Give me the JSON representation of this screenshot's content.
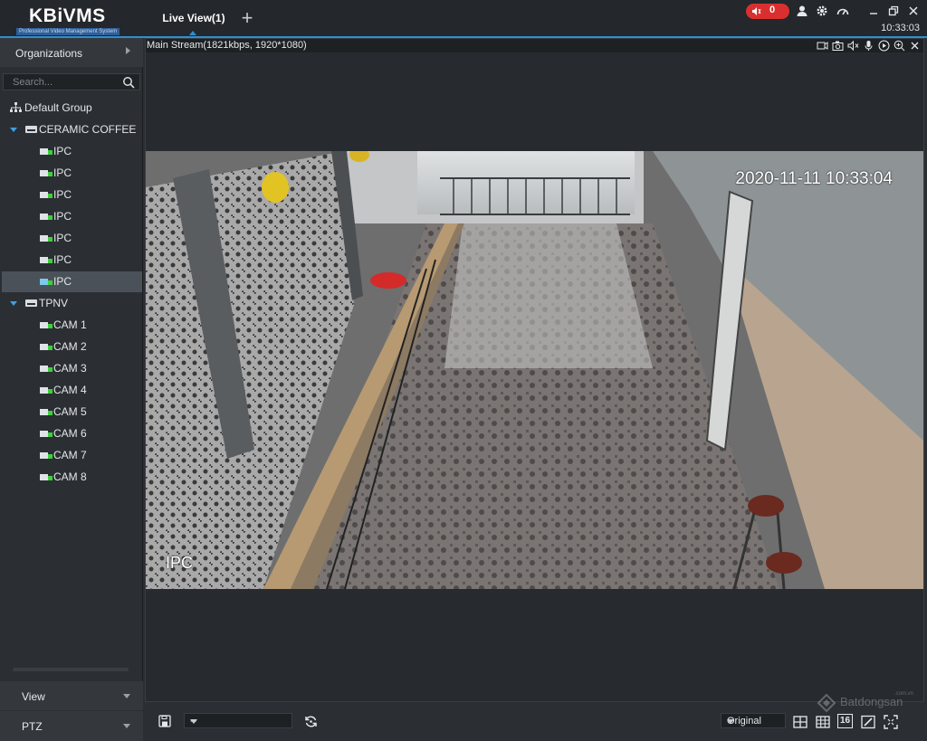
{
  "app": {
    "logo_text": "KBiVMS",
    "logo_subtitle": "Professional Video Management System",
    "tab_label": "Live View(1)",
    "alarm_count": "0",
    "clock": "10:33:03"
  },
  "sidebar": {
    "organizations_label": "Organizations",
    "search_placeholder": "Search...",
    "default_group": "Default Group",
    "groups": [
      {
        "name": "CERAMIC COFFEE",
        "devices": [
          "IPC",
          "IPC",
          "IPC",
          "IPC",
          "IPC",
          "IPC",
          "IPC"
        ]
      },
      {
        "name": "TPNV",
        "devices": [
          "CAM 1",
          "CAM 2",
          "CAM 3",
          "CAM 4",
          "CAM 5",
          "CAM 6",
          "CAM 7",
          "CAM 8"
        ]
      }
    ],
    "view_label": "View",
    "ptz_label": "PTZ"
  },
  "viewer": {
    "stream_info": "Main Stream(1821kbps, 1920*1080)",
    "timestamp": "2020-11-11 10:33:04",
    "camera_label": "IPC"
  },
  "bottom": {
    "layout_value": "--",
    "scale_value": "Original",
    "split_16_label": "16"
  },
  "watermark": {
    "text": "Batdongsan",
    "domain": ".com.vn"
  },
  "colors": {
    "accent": "#2f8fd0",
    "alarm": "#d9302f",
    "online": "#3bd13b"
  }
}
